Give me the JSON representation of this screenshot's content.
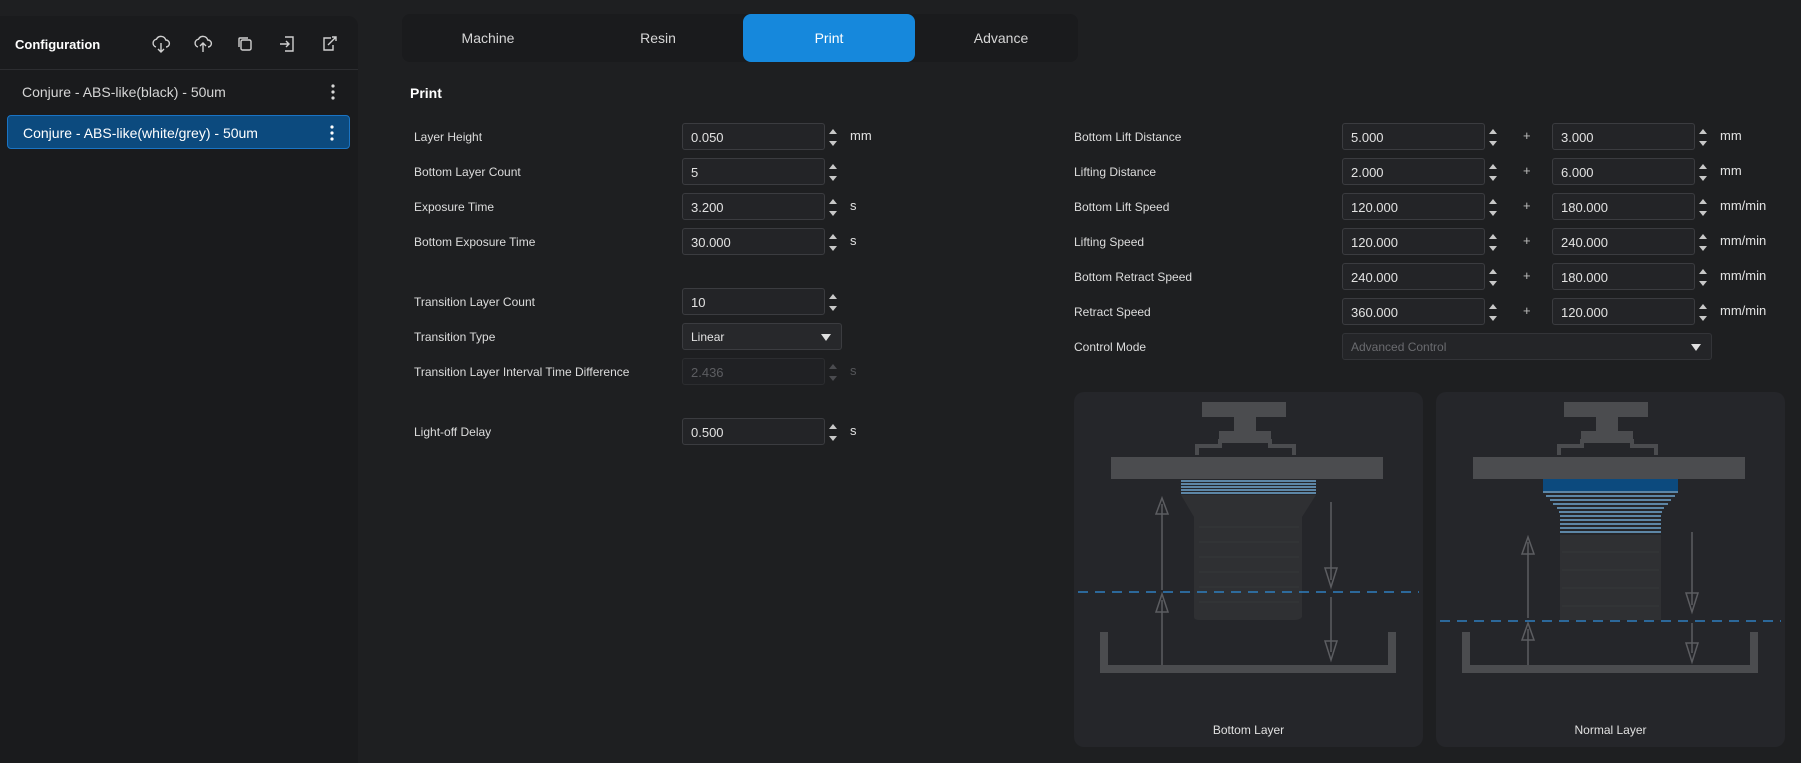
{
  "sidebar": {
    "title": "Configuration",
    "tools": [
      "cloud-download-icon",
      "cloud-upload-icon",
      "copy-icon",
      "import-icon",
      "export-icon"
    ],
    "presets": [
      {
        "label": "Conjure - ABS-like(black) - 50um",
        "active": false
      },
      {
        "label": "Conjure - ABS-like(white/grey) - 50um",
        "active": true
      }
    ]
  },
  "tabs": [
    {
      "label": "Machine"
    },
    {
      "label": "Resin"
    },
    {
      "label": "Print",
      "active": true
    },
    {
      "label": "Advance"
    }
  ],
  "section_title": "Print",
  "left_fields": {
    "layer_height": {
      "label": "Layer Height",
      "value": "0.050",
      "unit": "mm"
    },
    "bottom_layer_count": {
      "label": "Bottom Layer Count",
      "value": "5"
    },
    "exposure_time": {
      "label": "Exposure Time",
      "value": "3.200",
      "unit": "s"
    },
    "bottom_exposure_time": {
      "label": "Bottom Exposure Time",
      "value": "30.000",
      "unit": "s"
    },
    "transition_layer_count": {
      "label": "Transition Layer Count",
      "value": "10"
    },
    "transition_type": {
      "label": "Transition Type",
      "value": "Linear"
    },
    "transition_interval": {
      "label": "Transition Layer Interval Time Difference",
      "value": "2.436",
      "unit": "s",
      "disabled": true
    },
    "light_off_delay": {
      "label": "Light-off Delay",
      "value": "0.500",
      "unit": "s"
    }
  },
  "right_fields": [
    {
      "label": "Bottom Lift Distance",
      "value1": "5.000",
      "value2": "3.000",
      "unit": "mm"
    },
    {
      "label": "Lifting Distance",
      "value1": "2.000",
      "value2": "6.000",
      "unit": "mm"
    },
    {
      "label": "Bottom Lift Speed",
      "value1": "120.000",
      "value2": "180.000",
      "unit": "mm/min"
    },
    {
      "label": "Lifting Speed",
      "value1": "120.000",
      "value2": "240.000",
      "unit": "mm/min"
    },
    {
      "label": "Bottom Retract Speed",
      "value1": "240.000",
      "value2": "180.000",
      "unit": "mm/min"
    },
    {
      "label": "Retract Speed",
      "value1": "360.000",
      "value2": "120.000",
      "unit": "mm/min"
    }
  ],
  "plus_sign": "+",
  "control_mode": {
    "label": "Control Mode",
    "value": "Advanced Control",
    "disabled": true
  },
  "diagrams": [
    {
      "caption": "Bottom Layer"
    },
    {
      "caption": "Normal Layer"
    }
  ],
  "colors": {
    "accent": "#1688dc",
    "selected": "#0c4a7e",
    "layer_blue": "#7fbff0",
    "dash_blue": "#2f7fbf"
  }
}
